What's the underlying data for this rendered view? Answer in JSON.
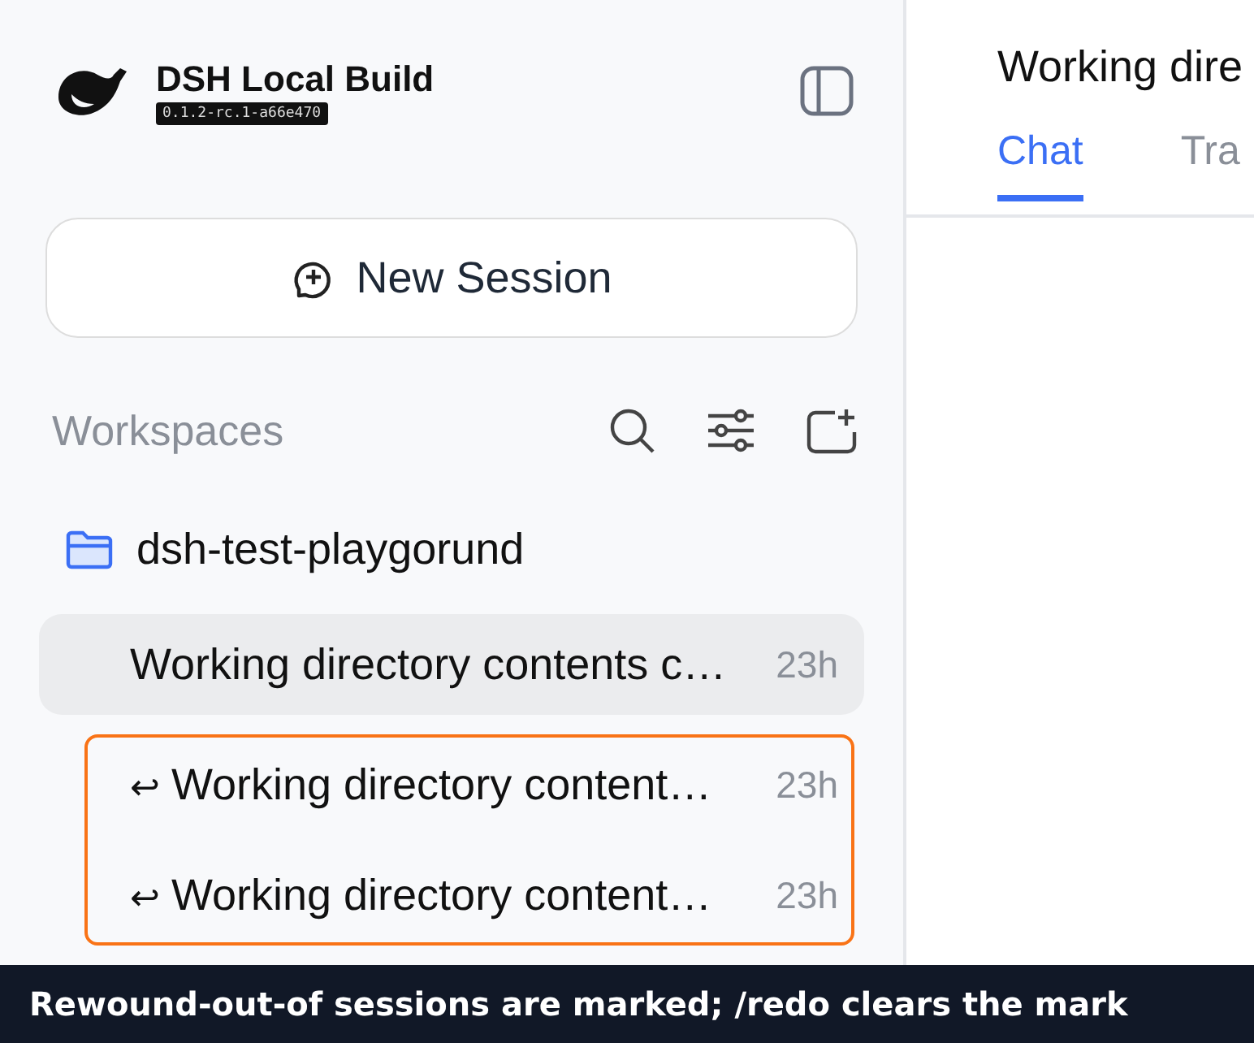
{
  "app": {
    "title": "DSH Local Build",
    "version": "0.1.2-rc.1-a66e470"
  },
  "new_session_button": {
    "label": "New Session"
  },
  "workspaces": {
    "heading": "Workspaces",
    "folder": {
      "name": "dsh-test-playgorund",
      "expanded": true
    },
    "sessions": [
      {
        "title": "Working directory contents c…",
        "age": "23h",
        "selected": true,
        "rewound": false
      },
      {
        "title": "Working directory content…",
        "age": "23h",
        "selected": false,
        "rewound": true,
        "marker": "↩"
      },
      {
        "title": "Working directory content…",
        "age": "23h",
        "selected": false,
        "rewound": true,
        "marker": "↩"
      }
    ]
  },
  "main": {
    "title": "Working dire",
    "tabs": [
      {
        "label": "Chat",
        "selected": true
      },
      {
        "label": "Tra",
        "selected": false
      }
    ]
  },
  "caption": "Rewound-out-of sessions are marked; /redo clears the mark"
}
